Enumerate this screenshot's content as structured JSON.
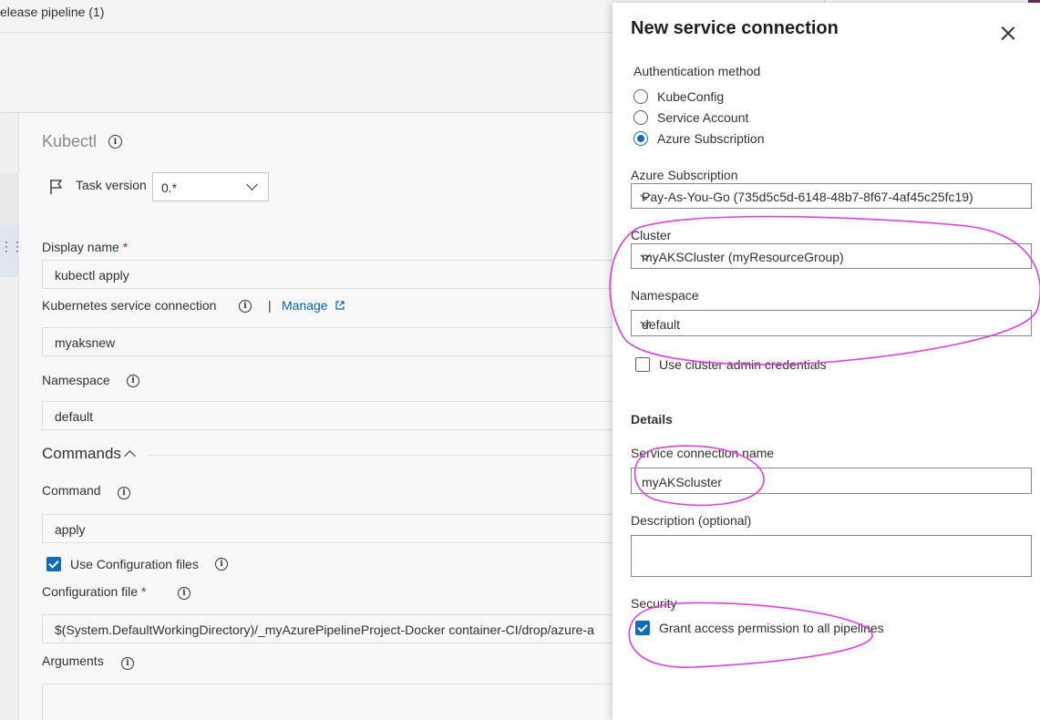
{
  "breadcrumb": "elease pipeline (1)",
  "task": {
    "title": "Kubectl",
    "task_version_label": "Task version",
    "task_version_value": "0.*"
  },
  "form": {
    "display_name_label": "Display name",
    "display_name_value": "kubectl apply",
    "k8s_connection_label": "Kubernetes service connection",
    "separator": "|",
    "manage_link": "Manage",
    "k8s_connection_value": "myaksnew",
    "namespace_label": "Namespace",
    "namespace_value": "default",
    "commands_section": "Commands",
    "command_label": "Command",
    "command_value": "apply",
    "use_config_files_label": "Use Configuration files",
    "config_file_label": "Configuration file",
    "config_file_value": "$(System.DefaultWorkingDirectory)/_myAzurePipelineProject-Docker container-CI/drop/azure-a",
    "arguments_label": "Arguments",
    "required_mark": "*"
  },
  "panel": {
    "title": "New service connection",
    "auth_method_label": "Authentication method",
    "auth_options": [
      "KubeConfig",
      "Service Account",
      "Azure Subscription"
    ],
    "auth_selected_index": 2,
    "azure_subscription_label": "Azure Subscription",
    "azure_subscription_value": "Pay-As-You-Go (735d5c5d-6148-48b7-8f67-4af45c25fc19)",
    "cluster_label": "Cluster",
    "cluster_value": "myAKSCluster (myResourceGroup)",
    "namespace_label": "Namespace",
    "namespace_value": "default",
    "use_admin_creds_label": "Use cluster admin credentials",
    "use_admin_creds_checked": false,
    "details_heading": "Details",
    "conn_name_label": "Service connection name",
    "conn_name_value": "myAKScluster",
    "description_label": "Description (optional)",
    "description_value": "",
    "security_label": "Security",
    "grant_access_label": "Grant access permission to all pipelines",
    "grant_access_checked": true
  },
  "colors": {
    "accent": "#0f6cbd",
    "link": "#0064b4",
    "annotation": "#e040e0",
    "required": "#a4262c"
  }
}
